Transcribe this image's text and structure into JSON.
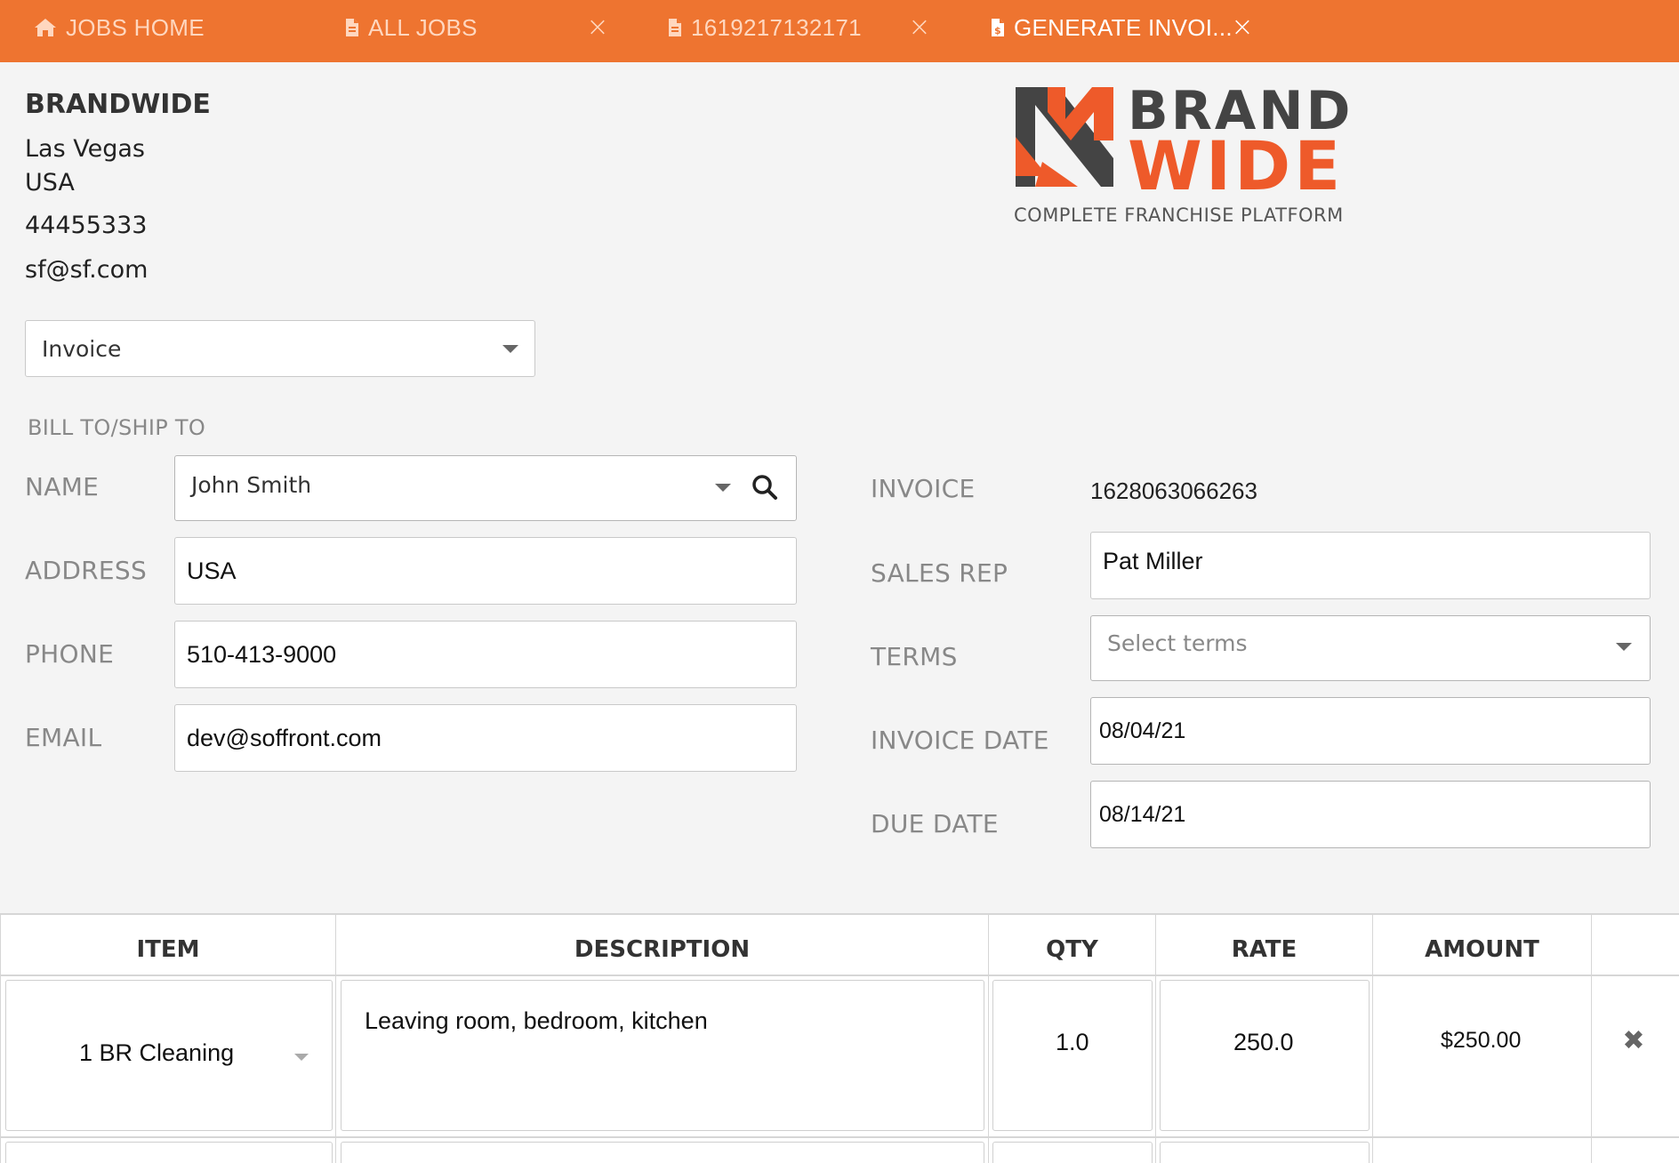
{
  "tabs": [
    {
      "label": "JOBS HOME",
      "icon": "home-icon",
      "closable": false,
      "active": false
    },
    {
      "label": "ALL JOBS",
      "icon": "document-icon",
      "closable": true,
      "active": false
    },
    {
      "label": "1619217132171",
      "icon": "document-icon",
      "closable": true,
      "active": false
    },
    {
      "label": "GENERATE INVOI...",
      "icon": "invoice-icon",
      "closable": true,
      "active": true
    }
  ],
  "tab_close_glyph": "×",
  "company": {
    "name": "BRANDWIDE",
    "city": "Las Vegas",
    "country": "USA",
    "phone": "44455333",
    "email": "sf@sf.com"
  },
  "logo": {
    "word1": "BRAND",
    "word2": "WIDE",
    "tagline": "COMPLETE FRANCHISE PLATFORM",
    "colors": {
      "orange": "#ee5a2a",
      "dark": "#444444"
    }
  },
  "doc_type": {
    "value": "Invoice"
  },
  "bill_to": {
    "section_label": "BILL TO/SHIP TO",
    "name_label": "NAME",
    "name_value": "John Smith",
    "address_label": "ADDRESS",
    "address_value": "USA",
    "phone_label": "PHONE",
    "phone_value": "510-413-9000",
    "email_label": "EMAIL",
    "email_value": "dev@soffront.com"
  },
  "invoice": {
    "invoice_label": "INVOICE",
    "invoice_number": "1628063066263",
    "sales_rep_label": "SALES REP",
    "sales_rep_value": "Pat Miller",
    "terms_label": "TERMS",
    "terms_placeholder": "Select terms",
    "invoice_date_label": "INVOICE DATE",
    "invoice_date_value": "08/04/21",
    "due_date_label": "DUE DATE",
    "due_date_value": "08/14/21"
  },
  "table": {
    "headers": {
      "item": "ITEM",
      "description": "DESCRIPTION",
      "qty": "QTY",
      "rate": "RATE",
      "amount": "AMOUNT"
    },
    "rows": [
      {
        "item": "1 BR Cleaning",
        "description": "Leaving room, bedroom, kitchen",
        "qty": "1.0",
        "rate": "250.0",
        "amount": "$250.00"
      }
    ],
    "remove_glyph": "✖"
  },
  "colors": {
    "accent": "#ee7430",
    "tab_inactive_text": "#ffd7bf"
  }
}
